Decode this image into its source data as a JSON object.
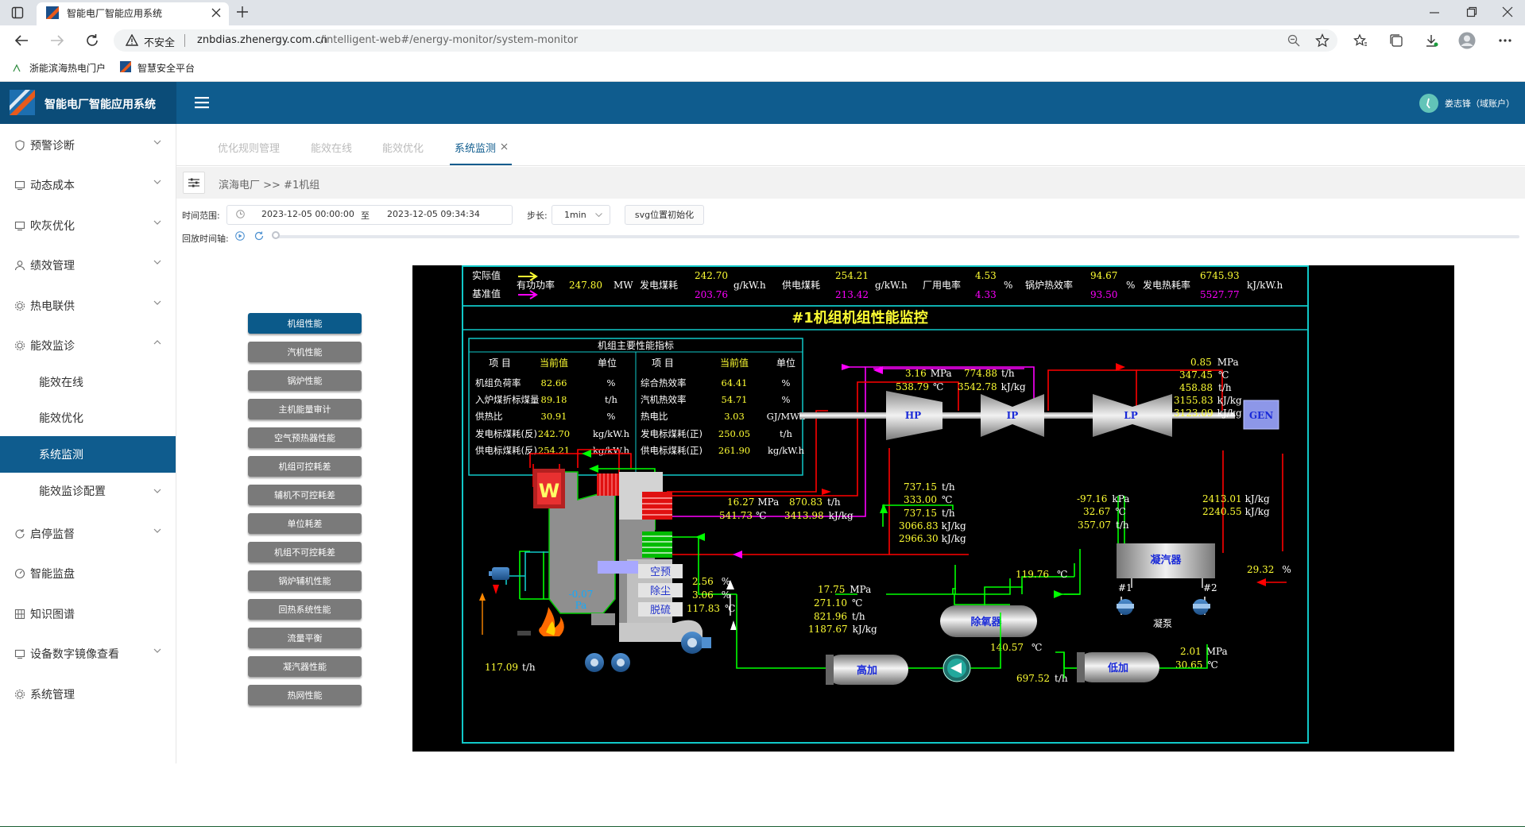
{
  "browser": {
    "tab_title": "智能电厂智能应用系统",
    "security_label": "不安全",
    "url_host": "znbdias.zhenergy.com.cn",
    "url_path": "/intelligent-web#/energy-monitor/system-monitor",
    "bookmarks": [
      "浙能滨海热电门户",
      "智慧安全平台"
    ]
  },
  "app": {
    "title": "智能电厂智能应用系统",
    "user": "娄志锋（域账户）"
  },
  "sidebar": {
    "items": [
      {
        "label": "预警诊断",
        "icon": "shield-icon"
      },
      {
        "label": "动态成本",
        "icon": "monitor-icon"
      },
      {
        "label": "吹灰优化",
        "icon": "monitor-icon"
      },
      {
        "label": "绩效管理",
        "icon": "user-icon"
      },
      {
        "label": "热电联供",
        "icon": "gear-icon"
      },
      {
        "label": "能效监诊",
        "icon": "gear-icon"
      },
      {
        "label": "启停监督",
        "icon": "refresh-icon"
      },
      {
        "label": "智能监盘",
        "icon": "gauge-icon"
      },
      {
        "label": "知识图谱",
        "icon": "grid-icon"
      },
      {
        "label": "设备数字镜像查看",
        "icon": "monitor-icon"
      },
      {
        "label": "系统管理",
        "icon": "gear-icon"
      }
    ],
    "subitems": [
      "能效在线",
      "能效优化",
      "系统监测",
      "能效监诊配置"
    ]
  },
  "tabs": [
    "优化规则管理",
    "能效在线",
    "能效优化",
    "系统监测"
  ],
  "breadcrumb": "滨海电厂 >> #1机组",
  "controls": {
    "time_range_label": "时间范围:",
    "start": "2023-12-05 00:00:00",
    "to": "至",
    "end": "2023-12-05 09:34:34",
    "step_label": "步长:",
    "step_value": "1min",
    "reset_button": "svg位置初始化",
    "playback_label": "回放时间轴:"
  },
  "left_buttons": [
    "机组性能",
    "汽机性能",
    "锅炉性能",
    "主机能量审计",
    "空气预热器性能",
    "机组可控耗差",
    "辅机不可控耗差",
    "单位耗差",
    "机组不可控耗差",
    "锅炉辅机性能",
    "回热系统性能",
    "流量平衡",
    "凝汽器性能",
    "热网性能"
  ],
  "diagram": {
    "title": "#1机组机组性能监控",
    "actual_label": "实际值",
    "baseline_label": "基准值",
    "summary": [
      {
        "label": "有功功率",
        "actual": "247.80",
        "unit": "MW",
        "baseline": ""
      },
      {
        "label": "发电煤耗",
        "actual": "242.70",
        "unit": "g/kW.h",
        "baseline": "203.76"
      },
      {
        "label": "供电煤耗",
        "actual": "254.21",
        "unit": "g/kW.h",
        "baseline": "213.42"
      },
      {
        "label": "厂用电率",
        "actual": "4.53",
        "unit": "%",
        "baseline": "4.33"
      },
      {
        "label": "锅炉热效率",
        "actual": "94.67",
        "unit": "%",
        "baseline": "93.50"
      },
      {
        "label": "发电热耗率",
        "actual": "6745.93",
        "unit": "kJ/kW.h",
        "baseline": "5527.77"
      }
    ],
    "table_title": "机组主要性能指标",
    "table_headers": [
      "项 目",
      "当前值",
      "单位",
      "项 目",
      "当前值",
      "单位"
    ],
    "table_rows": [
      [
        "机组负荷率",
        "82.66",
        "%",
        "综合热效率",
        "64.41",
        "%"
      ],
      [
        "入炉煤折标煤量",
        "89.18",
        "t/h",
        "汽机热效率",
        "54.71",
        "%"
      ],
      [
        "供热比",
        "30.91",
        "%",
        "热电比",
        "3.03",
        "GJ/MWh"
      ],
      [
        "发电标煤耗(反)",
        "242.70",
        "kg/kW.h",
        "发电标煤耗(正)",
        "250.05",
        "t/h"
      ],
      [
        "供电标煤耗(反)",
        "254.21",
        "kg/kW.h",
        "供电标煤耗(正)",
        "261.90",
        "kg/kW.h"
      ]
    ],
    "turbines": [
      "HP",
      "IP",
      "LP",
      "GEN"
    ],
    "ip_inlet": {
      "p": "3.16",
      "p_unit": "MPa",
      "t": "538.79",
      "t_unit": "℃",
      "f": "774.88",
      "f_unit": "t/h",
      "h": "3542.78",
      "h_unit": "kJ/kg"
    },
    "lp_inlet": {
      "p": "0.85",
      "p_unit": "MPa",
      "t": "347.45",
      "t_unit": "℃",
      "f": "458.88",
      "f_unit": "t/h",
      "h1": "3155.83",
      "h1_unit": "kJ/kg",
      "h2": "3123.09",
      "h2_unit": "kJ/kg"
    },
    "hp_exhaust": {
      "f1": "737.15",
      "f1_unit": "t/h",
      "t": "333.00",
      "t_unit": "℃",
      "f2": "737.15",
      "f2_unit": "t/h",
      "h1": "3066.83",
      "h1_unit": "kJ/kg",
      "h2": "2966.30",
      "h2_unit": "kJ/kg"
    },
    "main_steam": {
      "p": "16.27",
      "p_unit": "MPa",
      "f": "870.83",
      "f_unit": "t/h",
      "t": "541.73",
      "t_unit": "℃",
      "h": "3413.98",
      "h_unit": "kJ/kg"
    },
    "lp_exhaust": {
      "p": "-97.16",
      "p_unit": "kPa",
      "t": "32.67",
      "t_unit": "℃",
      "f": "357.07",
      "f_unit": "t/h"
    },
    "lp_exhaust_h": {
      "h1": "2413.01",
      "h1_unit": "kJ/kg",
      "h2": "2240.55",
      "h2_unit": "kJ/kg"
    },
    "condenser": {
      "label": "凝汽器",
      "value": "29.32",
      "unit": "%"
    },
    "pumps": {
      "p1": "#1",
      "p2": "#2",
      "label": "凝泵"
    },
    "deaerator": {
      "label": "除氧器",
      "t_in": "119.76",
      "t_in_unit": "℃",
      "t_out": "140.57",
      "t_out_unit": "℃"
    },
    "feedwater": {
      "p": "17.75",
      "p_unit": "MPa",
      "t": "271.10",
      "t_unit": "℃",
      "f": "821.96",
      "f_unit": "t/h",
      "h": "1187.67",
      "h_unit": "kJ/kg"
    },
    "hp_heater": "高加",
    "lp_heater": "低加",
    "lp_heater_data": {
      "p": "2.01",
      "p_unit": "MPa",
      "t": "30.65",
      "t_unit": "℃",
      "f": "697.52",
      "f_unit": "t/h"
    },
    "boiler": {
      "pressure": "-0.07",
      "unit": "Pa",
      "coal_flow": "117.09",
      "coal_unit": "t/h"
    },
    "flue_gas": {
      "labels": [
        "空预",
        "除尘",
        "脱硫"
      ],
      "values": [
        "2.56",
        "3.06",
        "117.83"
      ],
      "units": [
        "%",
        "%",
        "℃"
      ]
    }
  }
}
